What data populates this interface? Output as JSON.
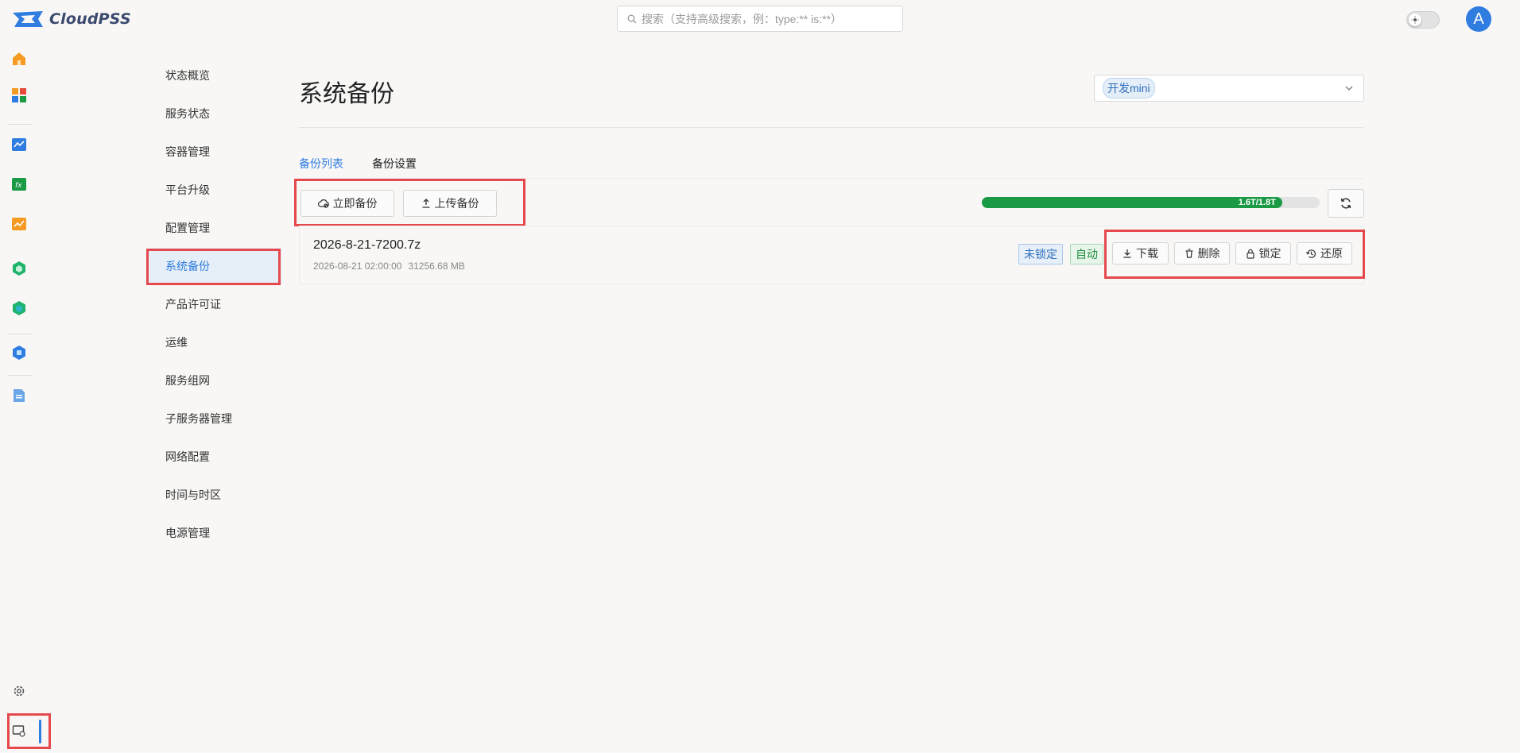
{
  "app": {
    "brand": "CloudPSS"
  },
  "search": {
    "placeholder": "搜索（支持高级搜索，例：type:** is:**）"
  },
  "user": {
    "avatar_letter": "A"
  },
  "rail": {
    "items": [
      {
        "name": "home-icon",
        "color": "#f59a23"
      },
      {
        "name": "apps-icon",
        "color": "#4a90e2"
      },
      {
        "name": "simstudio-icon",
        "color": "#2f7de1"
      },
      {
        "name": "function-icon",
        "color": "#1a9a45"
      },
      {
        "name": "chart-app-icon",
        "color": "#f59a23"
      },
      {
        "name": "hexagon-green-icon",
        "color": "#1fb36b"
      },
      {
        "name": "hexagon-teal-icon",
        "color": "#1fb36b"
      },
      {
        "name": "hexagon-blue-icon",
        "color": "#2f7de1"
      },
      {
        "name": "file-icon",
        "color": "#6aa6e8"
      }
    ],
    "settings_icon": "gear-icon",
    "admin_icon": "system-admin-icon"
  },
  "subnav": {
    "items": [
      "状态概览",
      "服务状态",
      "容器管理",
      "平台升级",
      "配置管理",
      "系统备份",
      "产品许可证",
      "运维",
      "服务组网",
      "子服务器管理",
      "网络配置",
      "时间与时区",
      "电源管理"
    ],
    "active_index": 5
  },
  "main": {
    "title": "系统备份",
    "cluster": {
      "selected": "开发mini"
    },
    "tabs": {
      "list": "备份列表",
      "settings": "备份设置",
      "active": "list"
    },
    "buttons": {
      "backup_now": "立即备份",
      "upload": "上传备份"
    },
    "storage": {
      "label": "1.6T/1.8T",
      "fraction": 0.889
    },
    "backups": [
      {
        "name": "2026-8-21-7200.7z",
        "time": "2026-08-21 02:00:00",
        "size": "31256.68 MB",
        "lock_status": "未锁定",
        "type": "自动",
        "actions": {
          "download": "下载",
          "delete": "删除",
          "lock": "锁定",
          "restore": "还原"
        }
      }
    ]
  },
  "colors": {
    "accent": "#2f7de1",
    "progress": "#1a9a45",
    "highlight": "#e5484d",
    "active_bg": "#e6eef7"
  }
}
